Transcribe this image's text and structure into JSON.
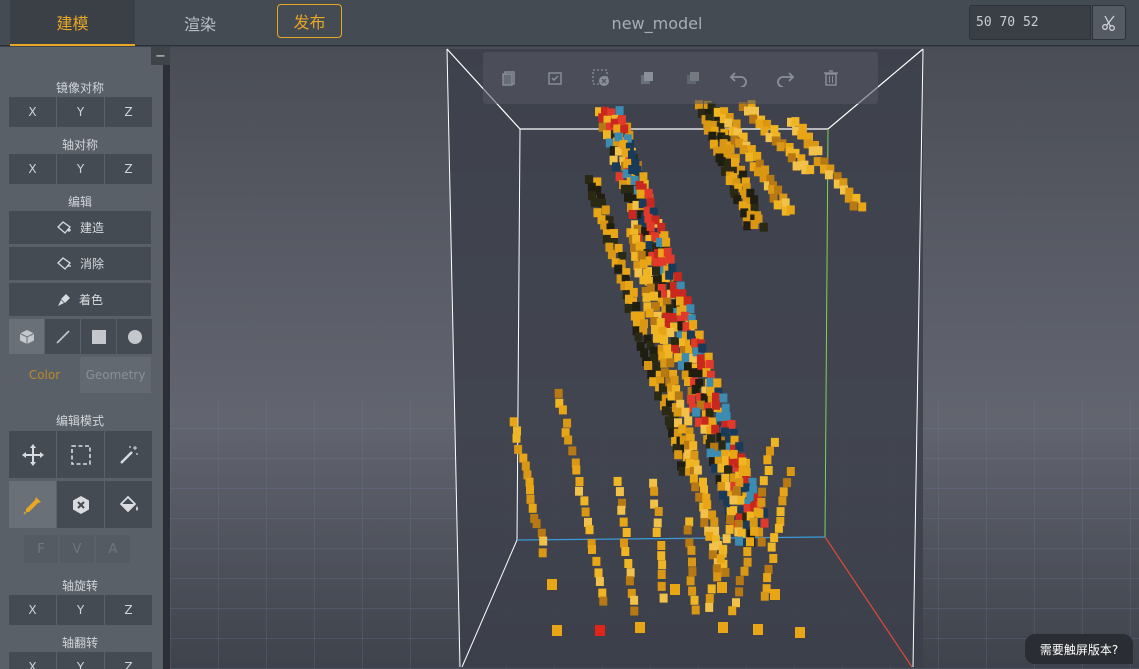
{
  "header": {
    "tabs": [
      {
        "label": "建模",
        "active": true
      },
      {
        "label": "渲染",
        "active": false
      }
    ],
    "publish_label": "发布",
    "title": "new_model",
    "dimensions": "50 70 52",
    "accent_color": "#e7a623"
  },
  "sidebar": {
    "collapse_symbol": "−",
    "mirror": {
      "label": "镜像对称",
      "axes": [
        "X",
        "Y",
        "Z"
      ]
    },
    "axis_symmetry": {
      "label": "轴对称",
      "axes": [
        "X",
        "Y",
        "Z"
      ]
    },
    "edit": {
      "label": "编辑",
      "tools": [
        {
          "label": "建造",
          "icon": "build-icon"
        },
        {
          "label": "消除",
          "icon": "erase-icon"
        },
        {
          "label": "着色",
          "icon": "paint-brush-icon"
        }
      ]
    },
    "shapes": [
      "cube-icon",
      "line-icon",
      "square-icon",
      "sphere-icon"
    ],
    "color_geometry": {
      "color_label": "Color",
      "geometry_label": "Geometry"
    },
    "edit_mode": {
      "label": "编辑模式",
      "modes": [
        "move-icon",
        "selection-icon",
        "magic-wand-icon",
        "eyedropper-icon",
        "hexagon-delete-icon",
        "paint-bucket-icon"
      ]
    },
    "fva": [
      "F",
      "V",
      "A"
    ],
    "axis_rotate": {
      "label": "轴旋转",
      "axes": [
        "X",
        "Y",
        "Z"
      ]
    },
    "axis_flip": {
      "label": "轴翻转",
      "axes": [
        "X",
        "Y",
        "Z"
      ]
    }
  },
  "toolbar_icons": [
    "copy-icon",
    "paste-icon",
    "delete-selection-icon",
    "duplicate-icon",
    "merge-icon",
    "undo-icon",
    "redo-icon",
    "trash-icon"
  ],
  "touch_prompt": "需要触屏版本?"
}
